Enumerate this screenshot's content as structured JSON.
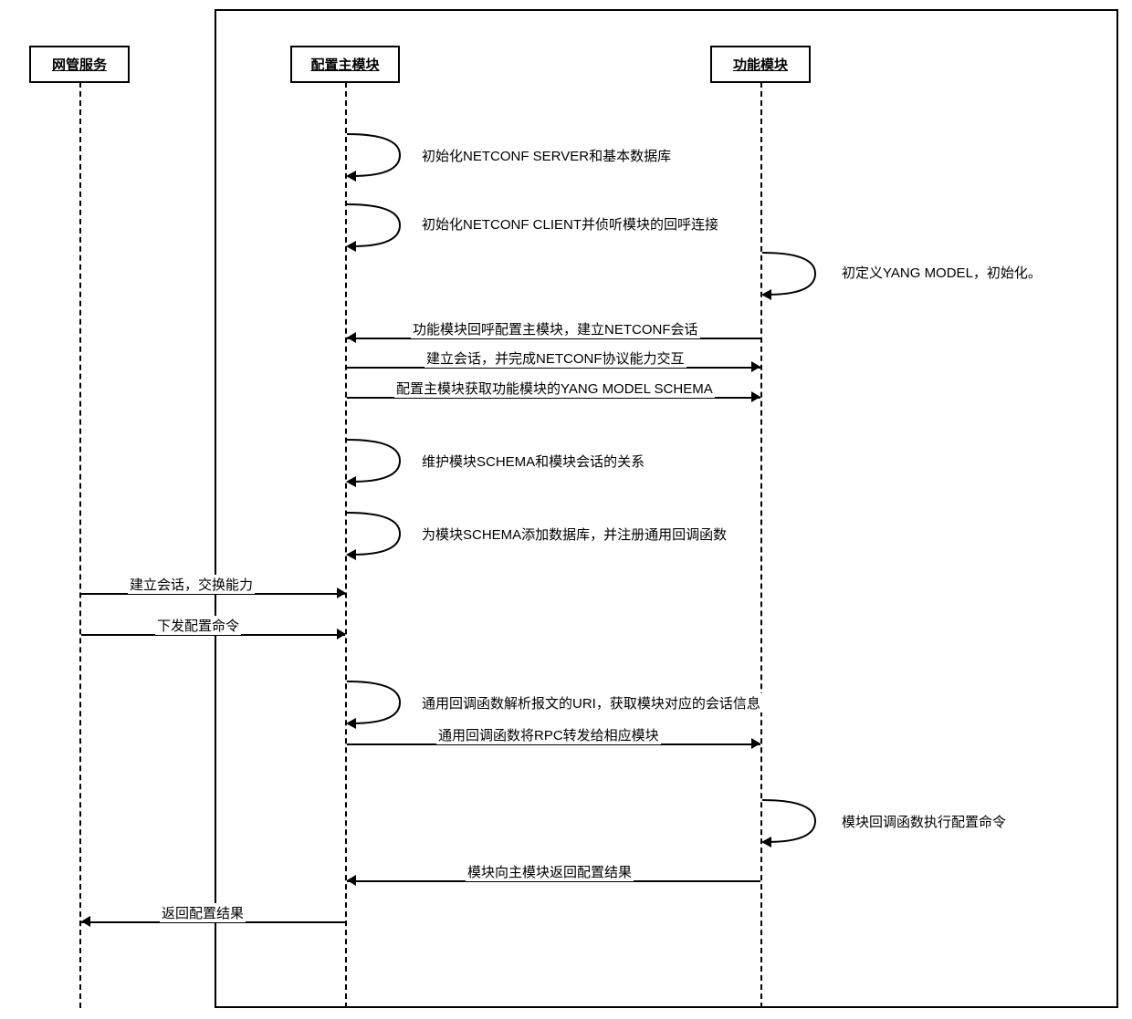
{
  "diagram": {
    "type": "uml-sequence",
    "actors": {
      "nms": "网管服务",
      "main": "配置主模块",
      "func": "功能模块"
    },
    "messages": {
      "s1": "初始化NETCONF SERVER和基本数据库",
      "s2": "初始化NETCONF CLIENT并侦听模块的回呼连接",
      "s3": "初定义YANG MODEL，初始化。",
      "m1": "功能模块回呼配置主模块，建立NETCONF会话",
      "m2": "建立会话，并完成NETCONF协议能力交互",
      "m3": "配置主模块获取功能模块的YANG MODEL SCHEMA",
      "s4": "维护模块SCHEMA和模块会话的关系",
      "s5": "为模块SCHEMA添加数据库，并注册通用回调函数",
      "m4": "建立会话，交换能力",
      "m5": "下发配置命令",
      "s6": "通用回调函数解析报文的URI，获取模块对应的会话信息",
      "m6": "通用回调函数将RPC转发给相应模块",
      "s7": "模块回调函数执行配置命令",
      "m7": "模块向主模块返回配置结果",
      "m8": "返回配置结果"
    }
  }
}
